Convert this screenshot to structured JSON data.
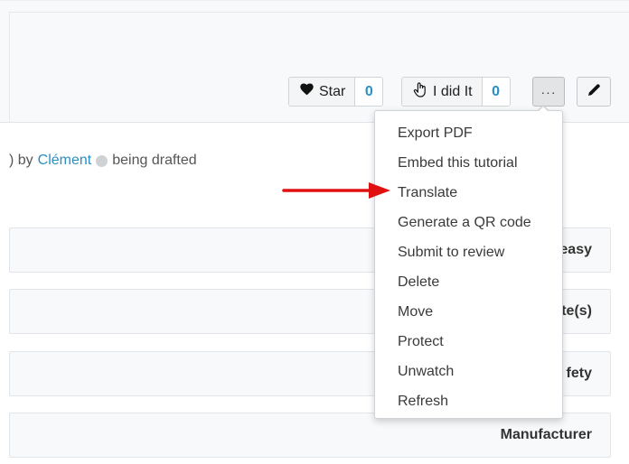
{
  "toolbar": {
    "star_label": "Star",
    "star_count": "0",
    "did_it_label": "I did It",
    "did_it_count": "0",
    "more_label": "···"
  },
  "byline": {
    "prefix": ") by",
    "author": "Clément",
    "status": "being drafted"
  },
  "rows": [
    {
      "label": "easy"
    },
    {
      "label": "te(s)"
    },
    {
      "label": "fety"
    },
    {
      "label": "Manufacturer"
    }
  ],
  "menu": {
    "items": [
      {
        "label": "Export PDF"
      },
      {
        "label": "Embed this tutorial"
      },
      {
        "label": "Translate"
      },
      {
        "label": "Generate a QR code"
      },
      {
        "label": "Submit to review"
      },
      {
        "label": "Delete"
      },
      {
        "label": "Move"
      },
      {
        "label": "Protect"
      },
      {
        "label": "Unwatch"
      },
      {
        "label": "Refresh"
      }
    ]
  },
  "icons": {
    "star": "heart-icon",
    "did_it": "hand-icon",
    "edit": "pencil-icon",
    "annotation": "red-arrow"
  },
  "colors": {
    "accent": "#2a8fc3",
    "annotation_arrow": "#e01010"
  }
}
